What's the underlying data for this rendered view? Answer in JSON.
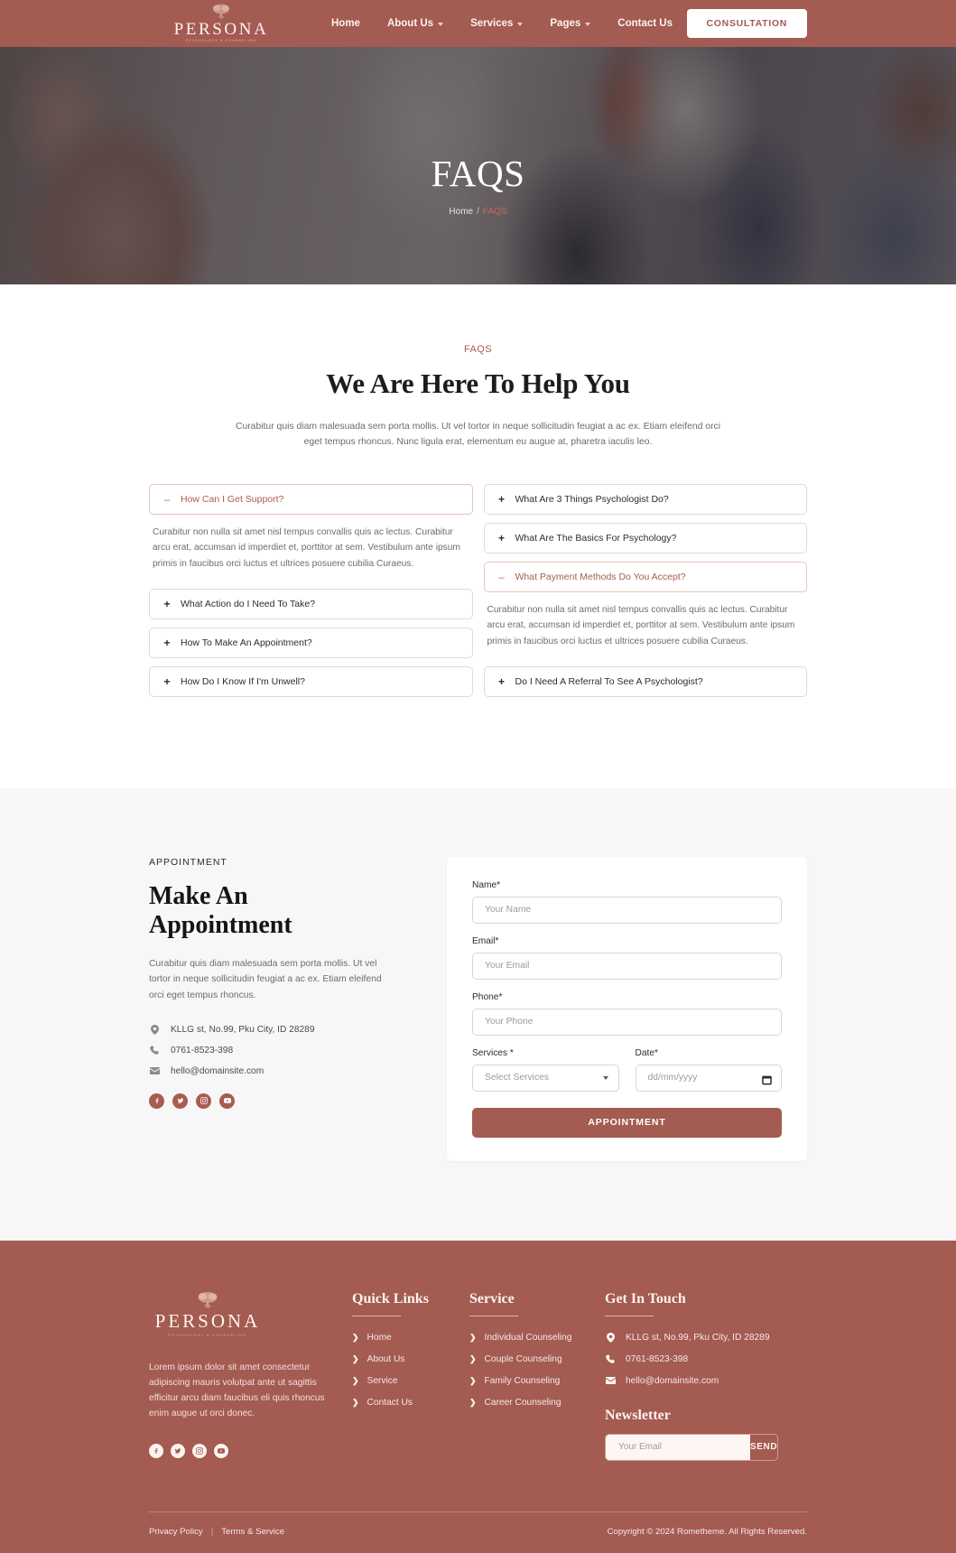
{
  "brand": {
    "name": "PERSONA",
    "tagline": "PSYCHOLOGY & COUNSELING",
    "color": "#a35b52",
    "accent": "#a85c50",
    "logo_icon": "brain-tree-icon"
  },
  "header": {
    "nav": [
      {
        "label": "Home",
        "has_dropdown": false
      },
      {
        "label": "About Us",
        "has_dropdown": true
      },
      {
        "label": "Services",
        "has_dropdown": true
      },
      {
        "label": "Pages",
        "has_dropdown": true
      },
      {
        "label": "Contact Us",
        "has_dropdown": false
      }
    ],
    "cta_label": "CONSULTATION"
  },
  "hero": {
    "title": "FAQS",
    "breadcrumb_home": "Home",
    "breadcrumb_sep": "/",
    "breadcrumb_current": "FAQS"
  },
  "faq": {
    "eyebrow": "FAQS",
    "title": "We Are Here To Help You",
    "description": "Curabitur quis diam malesuada sem porta mollis. Ut vel tortor in neque sollicitudin feugiat a ac ex. Etiam eleifend orci eget tempus rhoncus. Nunc ligula erat, elementum eu augue at, pharetra iaculis leo.",
    "answer_text": "Curabitur non nulla sit amet nisl tempus convallis quis ac lectus. Curabitur arcu erat, accumsan id imperdiet et, porttitor at sem. Vestibulum ante ipsum primis in faucibus orci luctus et ultrices posuere cubilia Curaeus.",
    "left_column": [
      {
        "question": "How Can I Get Support?",
        "open": true,
        "sign": "–"
      },
      {
        "question": "What Action do I Need To Take?",
        "open": false,
        "sign": "+"
      },
      {
        "question": "How To Make An Appointment?",
        "open": false,
        "sign": "+"
      },
      {
        "question": "How Do I Know If I'm Unwell?",
        "open": false,
        "sign": "+"
      }
    ],
    "right_column": [
      {
        "question": "What Are 3 Things Psychologist Do?",
        "open": false,
        "sign": "+"
      },
      {
        "question": "What Are The Basics For Psychology?",
        "open": false,
        "sign": "+"
      },
      {
        "question": "What Payment Methods Do You Accept?",
        "open": true,
        "sign": "–"
      },
      {
        "question": "Do I Need A Referral To See A Psychologist?",
        "open": false,
        "sign": "+"
      }
    ]
  },
  "appointment": {
    "eyebrow": "APPOINTMENT",
    "title_line1": "Make An",
    "title_line2": "Appointment",
    "description": "Curabitur quis diam malesuada sem porta mollis. Ut vel tortor in neque sollicitudin feugiat a ac ex. Etiam eleifend orci eget tempus rhoncus.",
    "address": "KLLG st, No.99, Pku City, ID 28289",
    "phone": "0761-8523-398",
    "email": "hello@domainsite.com",
    "socials": [
      "facebook-icon",
      "twitter-icon",
      "instagram-icon",
      "youtube-icon"
    ],
    "form": {
      "name_label": "Name*",
      "name_placeholder": "Your Name",
      "name_value": "",
      "email_label": "Email*",
      "email_placeholder": "Your Email",
      "email_value": "",
      "phone_label": "Phone*",
      "phone_placeholder": "Your Phone",
      "phone_value": "",
      "services_label": "Services *",
      "services_selected": "Select Services",
      "services_options": [
        "Select Services",
        "Individual Counseling",
        "Couple Counseling",
        "Family Counseling",
        "Career Counseling"
      ],
      "date_label": "Date*",
      "date_placeholder": "dd/mm/yyyy",
      "date_value": "",
      "submit_label": "APPOINTMENT"
    }
  },
  "footer": {
    "about": "Lorem ipsum dolor sit amet consectetur adipiscing mauris volutpat ante ut sagittis efficitur arcu diam faucibus eli quis rhoncus enim augue ut orci donec.",
    "socials": [
      "facebook-icon",
      "twitter-icon",
      "instagram-icon",
      "youtube-icon"
    ],
    "quick_links": {
      "title": "Quick Links",
      "items": [
        "Home",
        "About Us",
        "Service",
        "Contact Us"
      ]
    },
    "service": {
      "title": "Service",
      "items": [
        "Individual Counseling",
        "Couple Counseling",
        "Family Counseling",
        "Career Counseling"
      ]
    },
    "get_in_touch": {
      "title": "Get In Touch",
      "address": "KLLG st, No.99, Pku City, ID 28289",
      "phone": "0761-8523-398",
      "email": "hello@domainsite.com"
    },
    "newsletter": {
      "title": "Newsletter",
      "placeholder": "Your Email",
      "value": "",
      "button_label": "SEND"
    },
    "bottom": {
      "privacy": "Privacy Policy",
      "separator": "|",
      "terms": "Terms & Service",
      "copyright": "Copyright © 2024 Rometheme. All Rights Reserved."
    }
  }
}
